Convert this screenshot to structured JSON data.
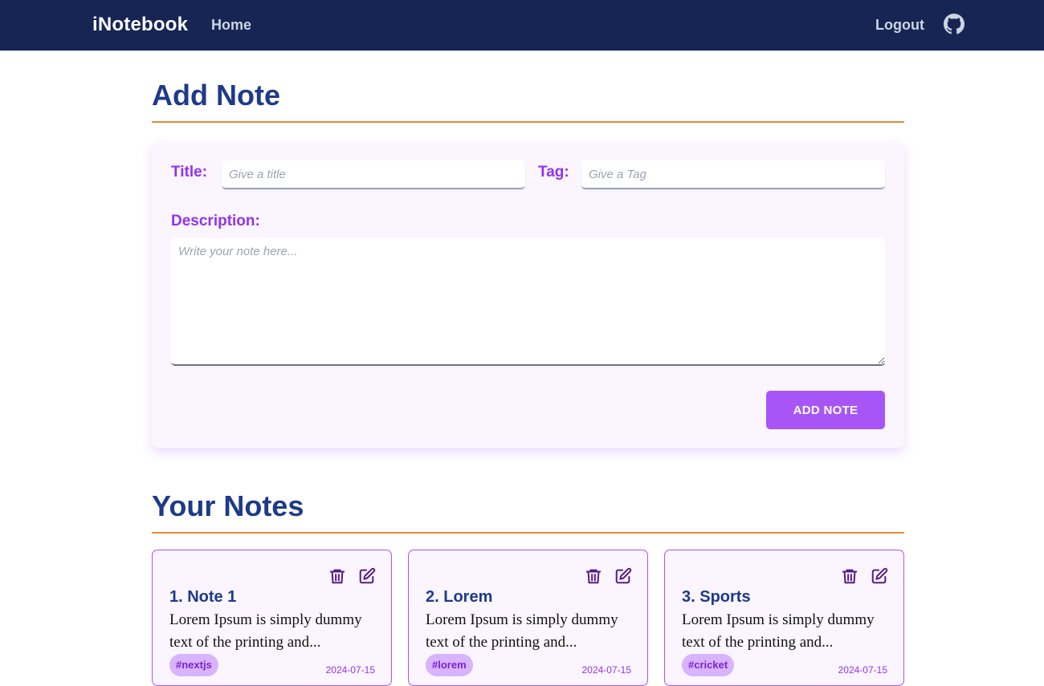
{
  "navbar": {
    "brand": "iNotebook",
    "home": "Home",
    "logout": "Logout",
    "github_icon": "github-icon"
  },
  "add_note": {
    "heading": "Add Note",
    "title_label": "Title:",
    "title_placeholder": "Give a title",
    "title_value": "",
    "tag_label": "Tag:",
    "tag_placeholder": "Give a Tag",
    "tag_value": "",
    "description_label": "Description:",
    "description_placeholder": "Write your note here...",
    "description_value": "",
    "submit_label": "ADD NOTE"
  },
  "your_notes": {
    "heading": "Your Notes",
    "notes": [
      {
        "title": "1. Note 1",
        "body": "Lorem Ipsum is simply dummy text of the printing and...",
        "tag": "#nextjs",
        "date": "2024-07-15"
      },
      {
        "title": "2. Lorem",
        "body": "Lorem Ipsum is simply dummy text of the printing and...",
        "tag": "#lorem",
        "date": "2024-07-15"
      },
      {
        "title": "3. Sports",
        "body": "Lorem Ipsum is simply dummy text of the printing and...",
        "tag": "#cricket",
        "date": "2024-07-15"
      }
    ]
  },
  "colors": {
    "navbar_bg": "#172554",
    "heading": "#1e3a8a",
    "accent_purple": "#a855f7",
    "label_purple": "#9333ea",
    "underline_orange": "#e88a3a",
    "card_bg": "#faf5ff"
  }
}
